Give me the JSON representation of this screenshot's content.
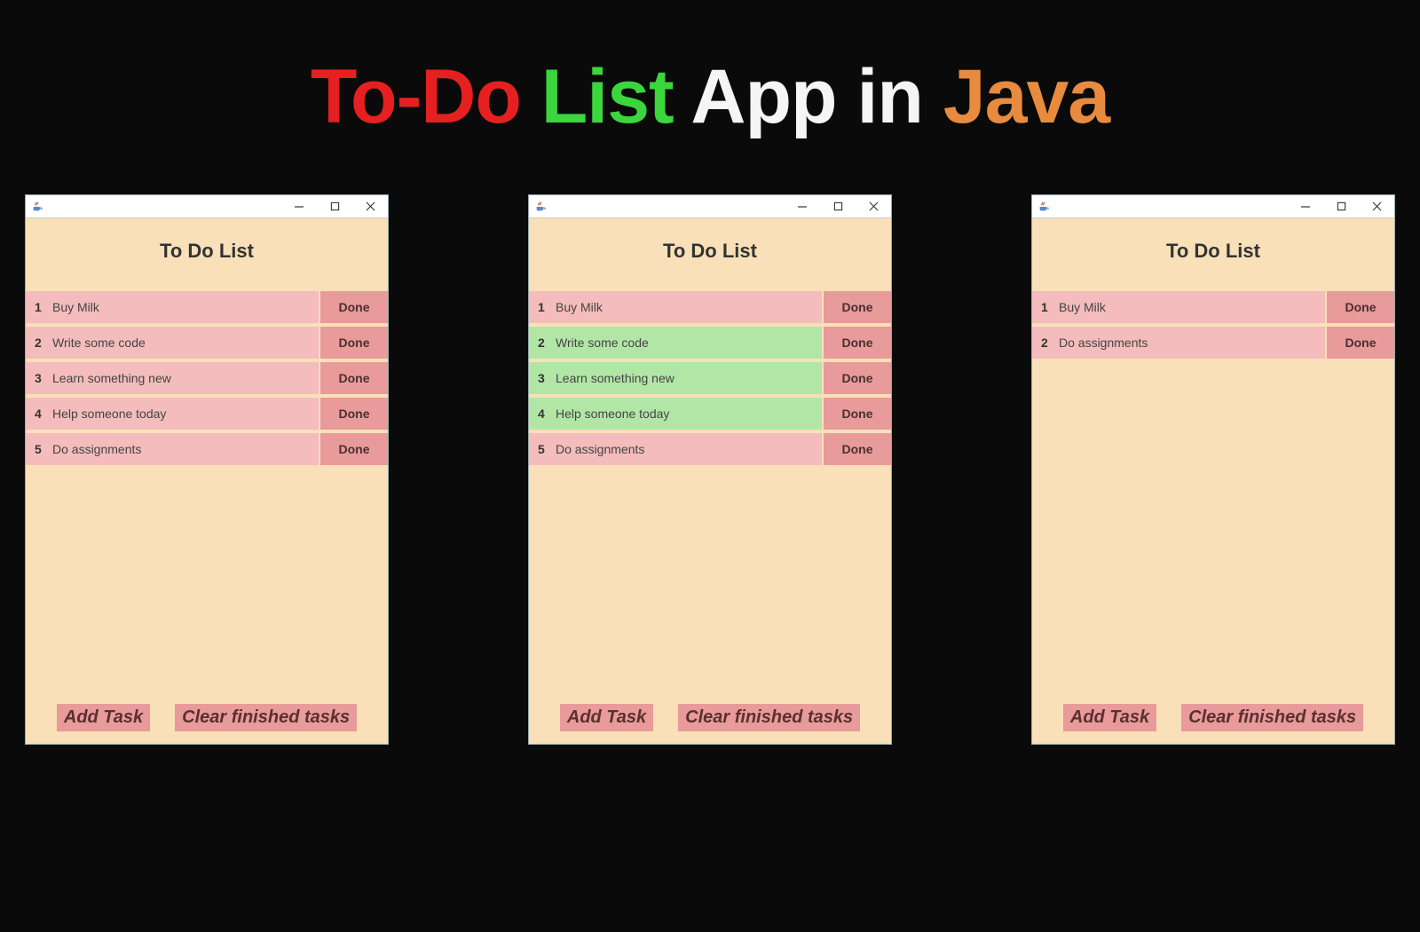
{
  "heading": {
    "part1": "To-Do",
    "part2": "List",
    "part3": "App in",
    "part4": "Java"
  },
  "common": {
    "app_title": "To Do List",
    "done_label": "Done",
    "add_task_label": "Add Task",
    "clear_label": "Clear finished tasks"
  },
  "windows": [
    {
      "tasks": [
        {
          "num": "1",
          "text": "Buy Milk",
          "state": "pending"
        },
        {
          "num": "2",
          "text": "Write some code",
          "state": "pending"
        },
        {
          "num": "3",
          "text": "Learn something new",
          "state": "pending"
        },
        {
          "num": "4",
          "text": "Help someone today",
          "state": "pending"
        },
        {
          "num": "5",
          "text": "Do assignments",
          "state": "pending"
        }
      ]
    },
    {
      "tasks": [
        {
          "num": "1",
          "text": "Buy Milk",
          "state": "pending"
        },
        {
          "num": "2",
          "text": "Write some code",
          "state": "done"
        },
        {
          "num": "3",
          "text": "Learn something new",
          "state": "done"
        },
        {
          "num": "4",
          "text": "Help someone today",
          "state": "done"
        },
        {
          "num": "5",
          "text": "Do assignments",
          "state": "pending"
        }
      ]
    },
    {
      "tasks": [
        {
          "num": "1",
          "text": "Buy Milk",
          "state": "pending"
        },
        {
          "num": "2",
          "text": "Do assignments",
          "state": "pending"
        }
      ]
    }
  ]
}
